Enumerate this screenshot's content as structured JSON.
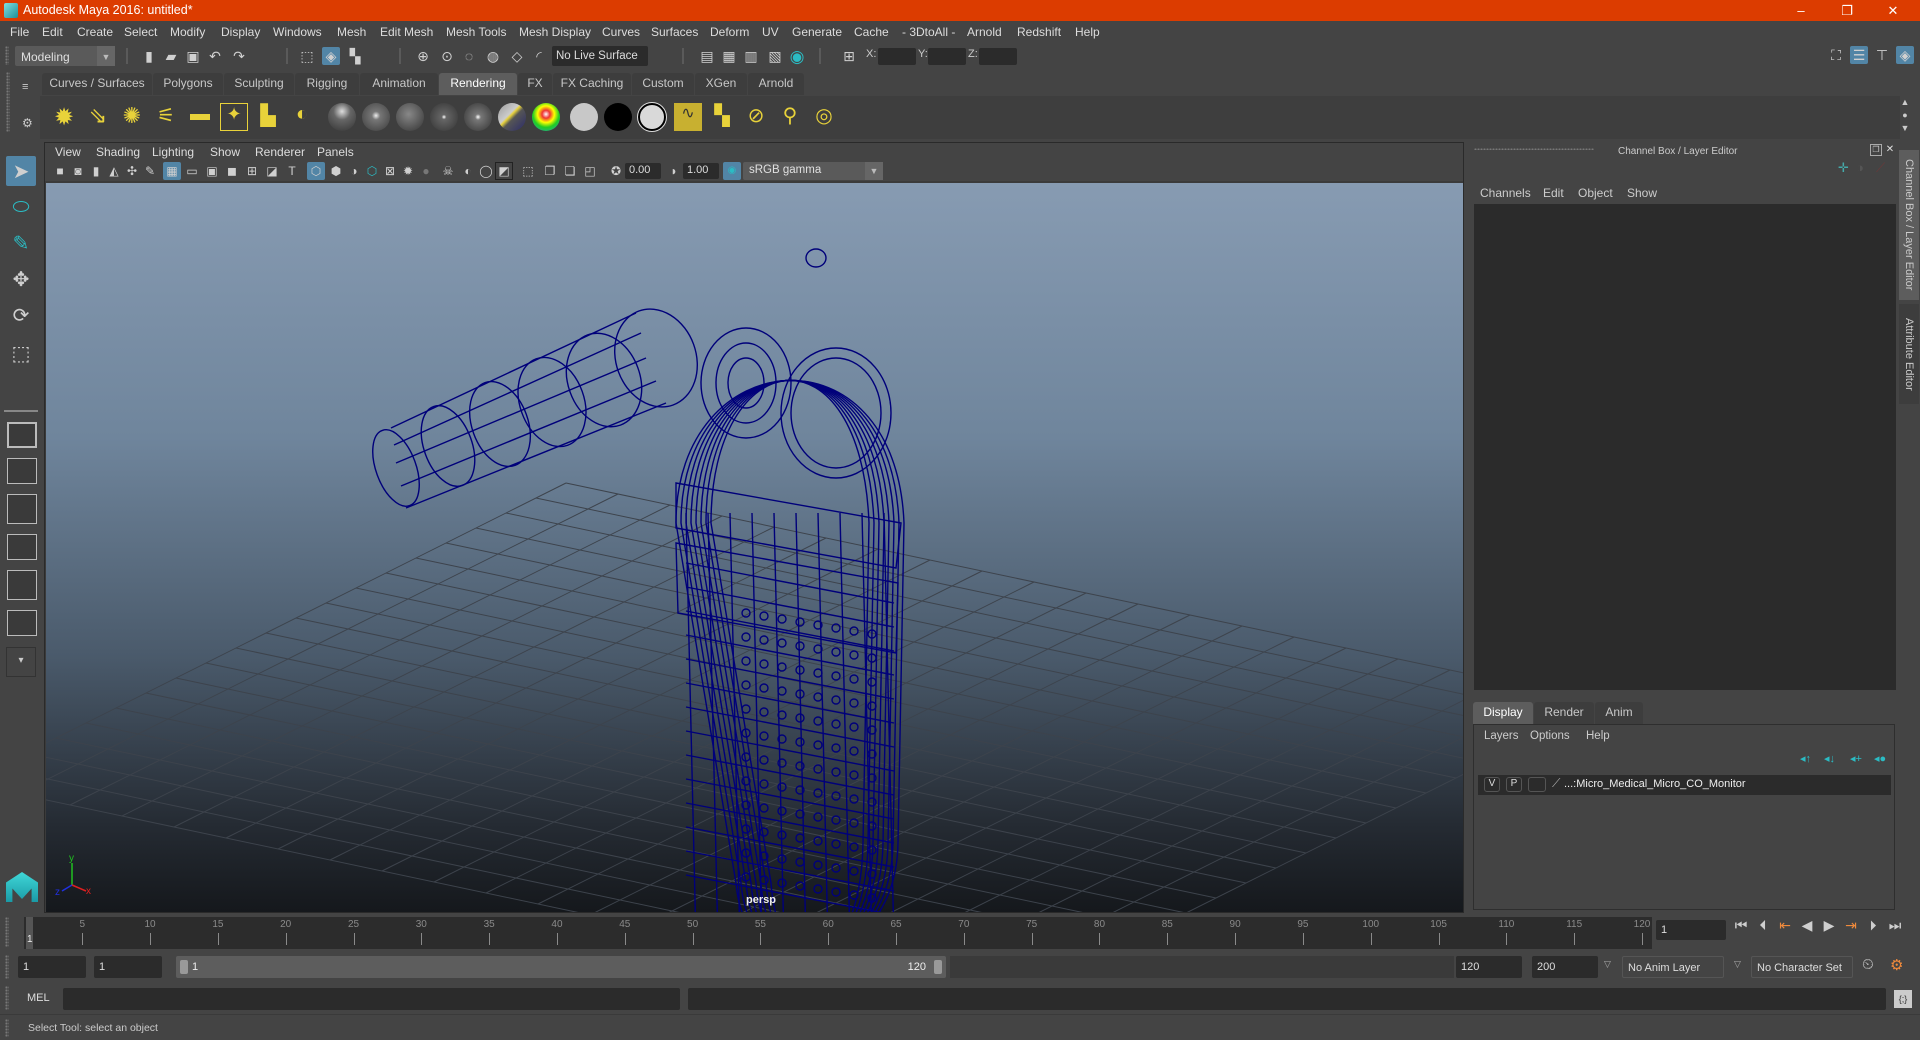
{
  "window": {
    "title": "Autodesk Maya 2016: untitled*",
    "controls": {
      "minimize": "–",
      "maximize": "❐",
      "close": "✕"
    }
  },
  "menubar": [
    "File",
    "Edit",
    "Create",
    "Select",
    "Modify",
    "Display",
    "Windows",
    "Mesh",
    "Edit Mesh",
    "Mesh Tools",
    "Mesh Display",
    "Curves",
    "Surfaces",
    "Deform",
    "UV",
    "Generate",
    "Cache",
    "- 3DtoAll -",
    "Arnold",
    "Redshift",
    "Help"
  ],
  "statusline": {
    "menuset": "Modeling",
    "live_surface": "No Live Surface",
    "x_label": "X:",
    "y_label": "Y:",
    "z_label": "Z:",
    "x_value": "",
    "y_value": "",
    "z_value": ""
  },
  "shelf": {
    "tabs": [
      "Curves / Surfaces",
      "Polygons",
      "Sculpting",
      "Rigging",
      "Animation",
      "Rendering",
      "FX",
      "FX Caching",
      "Custom",
      "XGen",
      "Arnold"
    ],
    "active_tab": "Rendering",
    "icons": [
      "ambient-light",
      "directional-light",
      "point-light",
      "spot-light",
      "area-light",
      "volume-light",
      "camera-aim",
      "render-settings",
      "blinn-material",
      "phong-material",
      "lambert-material",
      "phong-e-material",
      "anisotropic-material",
      "layered-shader",
      "ramp-shader",
      "surface-shader-gray",
      "use-background-shader",
      "surface-shader-white",
      "hypershade",
      "render-layer",
      "create-light-link",
      "break-light-link",
      "render-view"
    ]
  },
  "viewport": {
    "menu": [
      "View",
      "Shading",
      "Lighting",
      "Show",
      "Renderer",
      "Panels"
    ],
    "exposure": "0.00",
    "gamma": "1.00",
    "color_space": "sRGB gamma",
    "camera_label": "persp",
    "wireframe_color": "#00007a",
    "axis_labels": {
      "x": "x",
      "y": "y",
      "z": "z"
    }
  },
  "toolbox": {
    "tools": [
      "select-tool",
      "lasso-tool",
      "paint-select-tool",
      "move-tool",
      "rotate-tool",
      "scale-tool"
    ],
    "active_tool": "select-tool"
  },
  "channelbox": {
    "title": "Channel Box / Layer Editor",
    "menu": [
      "Channels",
      "Edit",
      "Object",
      "Show"
    ]
  },
  "layereditor": {
    "tabs": [
      "Display",
      "Render",
      "Anim"
    ],
    "active_tab": "Display",
    "menu": [
      "Layers",
      "Options",
      "Help"
    ],
    "layers": [
      {
        "visible": "V",
        "playback": "P",
        "name": "...:Micro_Medical_Micro_CO_Monitor"
      }
    ]
  },
  "right_tabs": [
    "Channel Box / Layer Editor",
    "Attribute Editor"
  ],
  "timeline": {
    "ticks": [
      5,
      10,
      15,
      20,
      25,
      30,
      35,
      40,
      45,
      50,
      55,
      60,
      65,
      70,
      75,
      80,
      85,
      90,
      95,
      100,
      105,
      110,
      115,
      120
    ],
    "start": 1,
    "end": 120,
    "current_frame": "1",
    "current_frame_marker": "1"
  },
  "range": {
    "start_time": "1",
    "playback_start": "1",
    "range_start_label": "1",
    "range_end_label": "120",
    "playback_end": "120",
    "end_time": "200",
    "anim_layer": "No Anim Layer",
    "character_set": "No Character Set"
  },
  "cmdline": {
    "label": "MEL",
    "input": "",
    "output": ""
  },
  "helpline": {
    "text": "Select Tool: select an object"
  },
  "colors": {
    "titlebar": "#dc3c00",
    "active_blue": "#5285a6",
    "accent_orange": "#f08a3c",
    "maya_teal": "#2bbcc4"
  }
}
